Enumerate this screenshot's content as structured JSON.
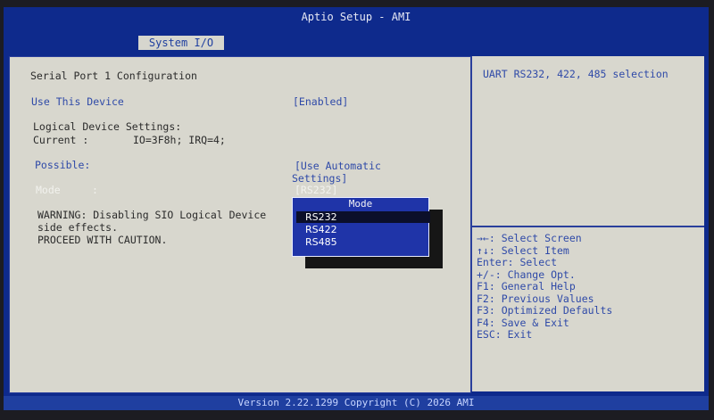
{
  "app_title": "Aptio Setup - AMI",
  "tab": {
    "label": "System I/O"
  },
  "main": {
    "page_title": "Serial Port  1 Configuration",
    "use_device": {
      "label": "Use This Device",
      "value": "[Enabled]"
    },
    "logical_settings": {
      "heading": "Logical Device Settings:",
      "current_label": "Current :",
      "current_value": "IO=3F8h; IRQ=4;"
    },
    "possible": {
      "label": "Possible:",
      "value_line1": "[Use Automatic",
      "value_line2": "Settings]"
    },
    "mode": {
      "label": "Mode",
      "separator": ":",
      "value": "[RS232]"
    },
    "warning_lines": [
      "WARNING: Disabling SIO Logical Device",
      "side effects.",
      "PROCEED WITH CAUTION."
    ]
  },
  "popup": {
    "title": "Mode",
    "options": [
      "RS232",
      "RS422",
      "RS485"
    ],
    "selected_index": 0
  },
  "help": {
    "description": "UART RS232, 422, 485 selection",
    "hotkeys": [
      "→←: Select Screen",
      "↑↓: Select Item",
      "Enter: Select",
      "+/-: Change Opt.",
      "F1: General Help",
      "F2: Previous Values",
      "F3: Optimized Defaults",
      "F4: Save & Exit",
      "ESC: Exit"
    ]
  },
  "footer": {
    "version": "Version 2.22.1299 Copyright (C) 2026 AMI"
  },
  "colors": {
    "screen_blue": "#0e2a8c",
    "panel_gray": "#d8d7ce",
    "help_text_blue": "#2f4aa8",
    "popup_blue": "#1f34a8"
  }
}
